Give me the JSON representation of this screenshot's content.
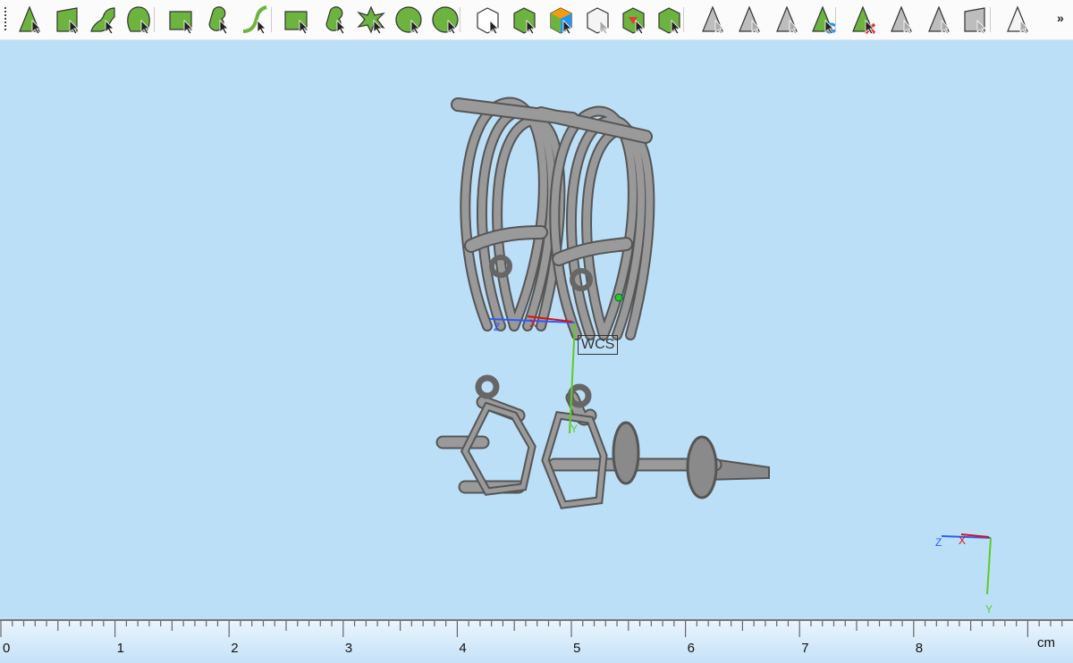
{
  "toolbar": {
    "tools": [
      {
        "name": "select-vertex",
        "shape": "tri",
        "color": "green"
      },
      {
        "name": "select-face",
        "shape": "quad",
        "color": "green"
      },
      {
        "name": "select-surface",
        "shape": "wave",
        "color": "green"
      },
      {
        "name": "select-shell",
        "shape": "shell",
        "color": "green"
      },
      {
        "name": "rect-brush",
        "shape": "rect",
        "color": "green"
      },
      {
        "name": "blob-brush",
        "shape": "blob",
        "color": "green"
      },
      {
        "name": "curve-brush",
        "shape": "curve",
        "color": "green"
      },
      {
        "name": "mesh-select",
        "shape": "rect",
        "color": "green"
      },
      {
        "name": "mesh-blob",
        "shape": "blob",
        "color": "green"
      },
      {
        "name": "star-select",
        "shape": "star",
        "color": "green"
      },
      {
        "name": "wheel-select",
        "shape": "circle",
        "color": "green"
      },
      {
        "name": "ellipse-select",
        "shape": "circle",
        "color": "green"
      },
      {
        "name": "cube-select-white",
        "shape": "cube",
        "color": "white"
      },
      {
        "name": "cube-select-green",
        "shape": "cube",
        "color": "green"
      },
      {
        "name": "cube-select-color",
        "shape": "cube",
        "color": "orange"
      },
      {
        "name": "cube-select-ghost",
        "shape": "cube",
        "color": "ghost"
      },
      {
        "name": "cube-select-red",
        "shape": "cube",
        "color": "red"
      },
      {
        "name": "cube-select-plus",
        "shape": "cube",
        "color": "green"
      },
      {
        "name": "gray-select",
        "shape": "tri",
        "color": "gray"
      },
      {
        "name": "gray-select-2",
        "shape": "tri",
        "color": "gray"
      },
      {
        "name": "gray-select-3",
        "shape": "tri",
        "color": "gray"
      },
      {
        "name": "swap-select",
        "shape": "tri",
        "color": "green"
      },
      {
        "name": "delete-select",
        "shape": "tri",
        "color": "green"
      },
      {
        "name": "gray-split",
        "shape": "tri",
        "color": "gray"
      },
      {
        "name": "gray-copy",
        "shape": "tri",
        "color": "gray"
      },
      {
        "name": "gray-plane",
        "shape": "quad",
        "color": "gray"
      },
      {
        "name": "view-select",
        "shape": "tri",
        "color": "ghost"
      }
    ],
    "more_label": "»"
  },
  "viewport": {
    "wcs_label": "WCS",
    "axis_z": "Z",
    "axis_x": "X",
    "axis_y": "Y"
  },
  "ruler": {
    "labels": [
      "0",
      "1",
      "2",
      "3",
      "4",
      "5",
      "6",
      "7",
      "8"
    ],
    "unit": "cm"
  },
  "colors": {
    "viewport_bg": "#bcdff8",
    "green": "#6db33f",
    "model": "#8a8a8a"
  }
}
